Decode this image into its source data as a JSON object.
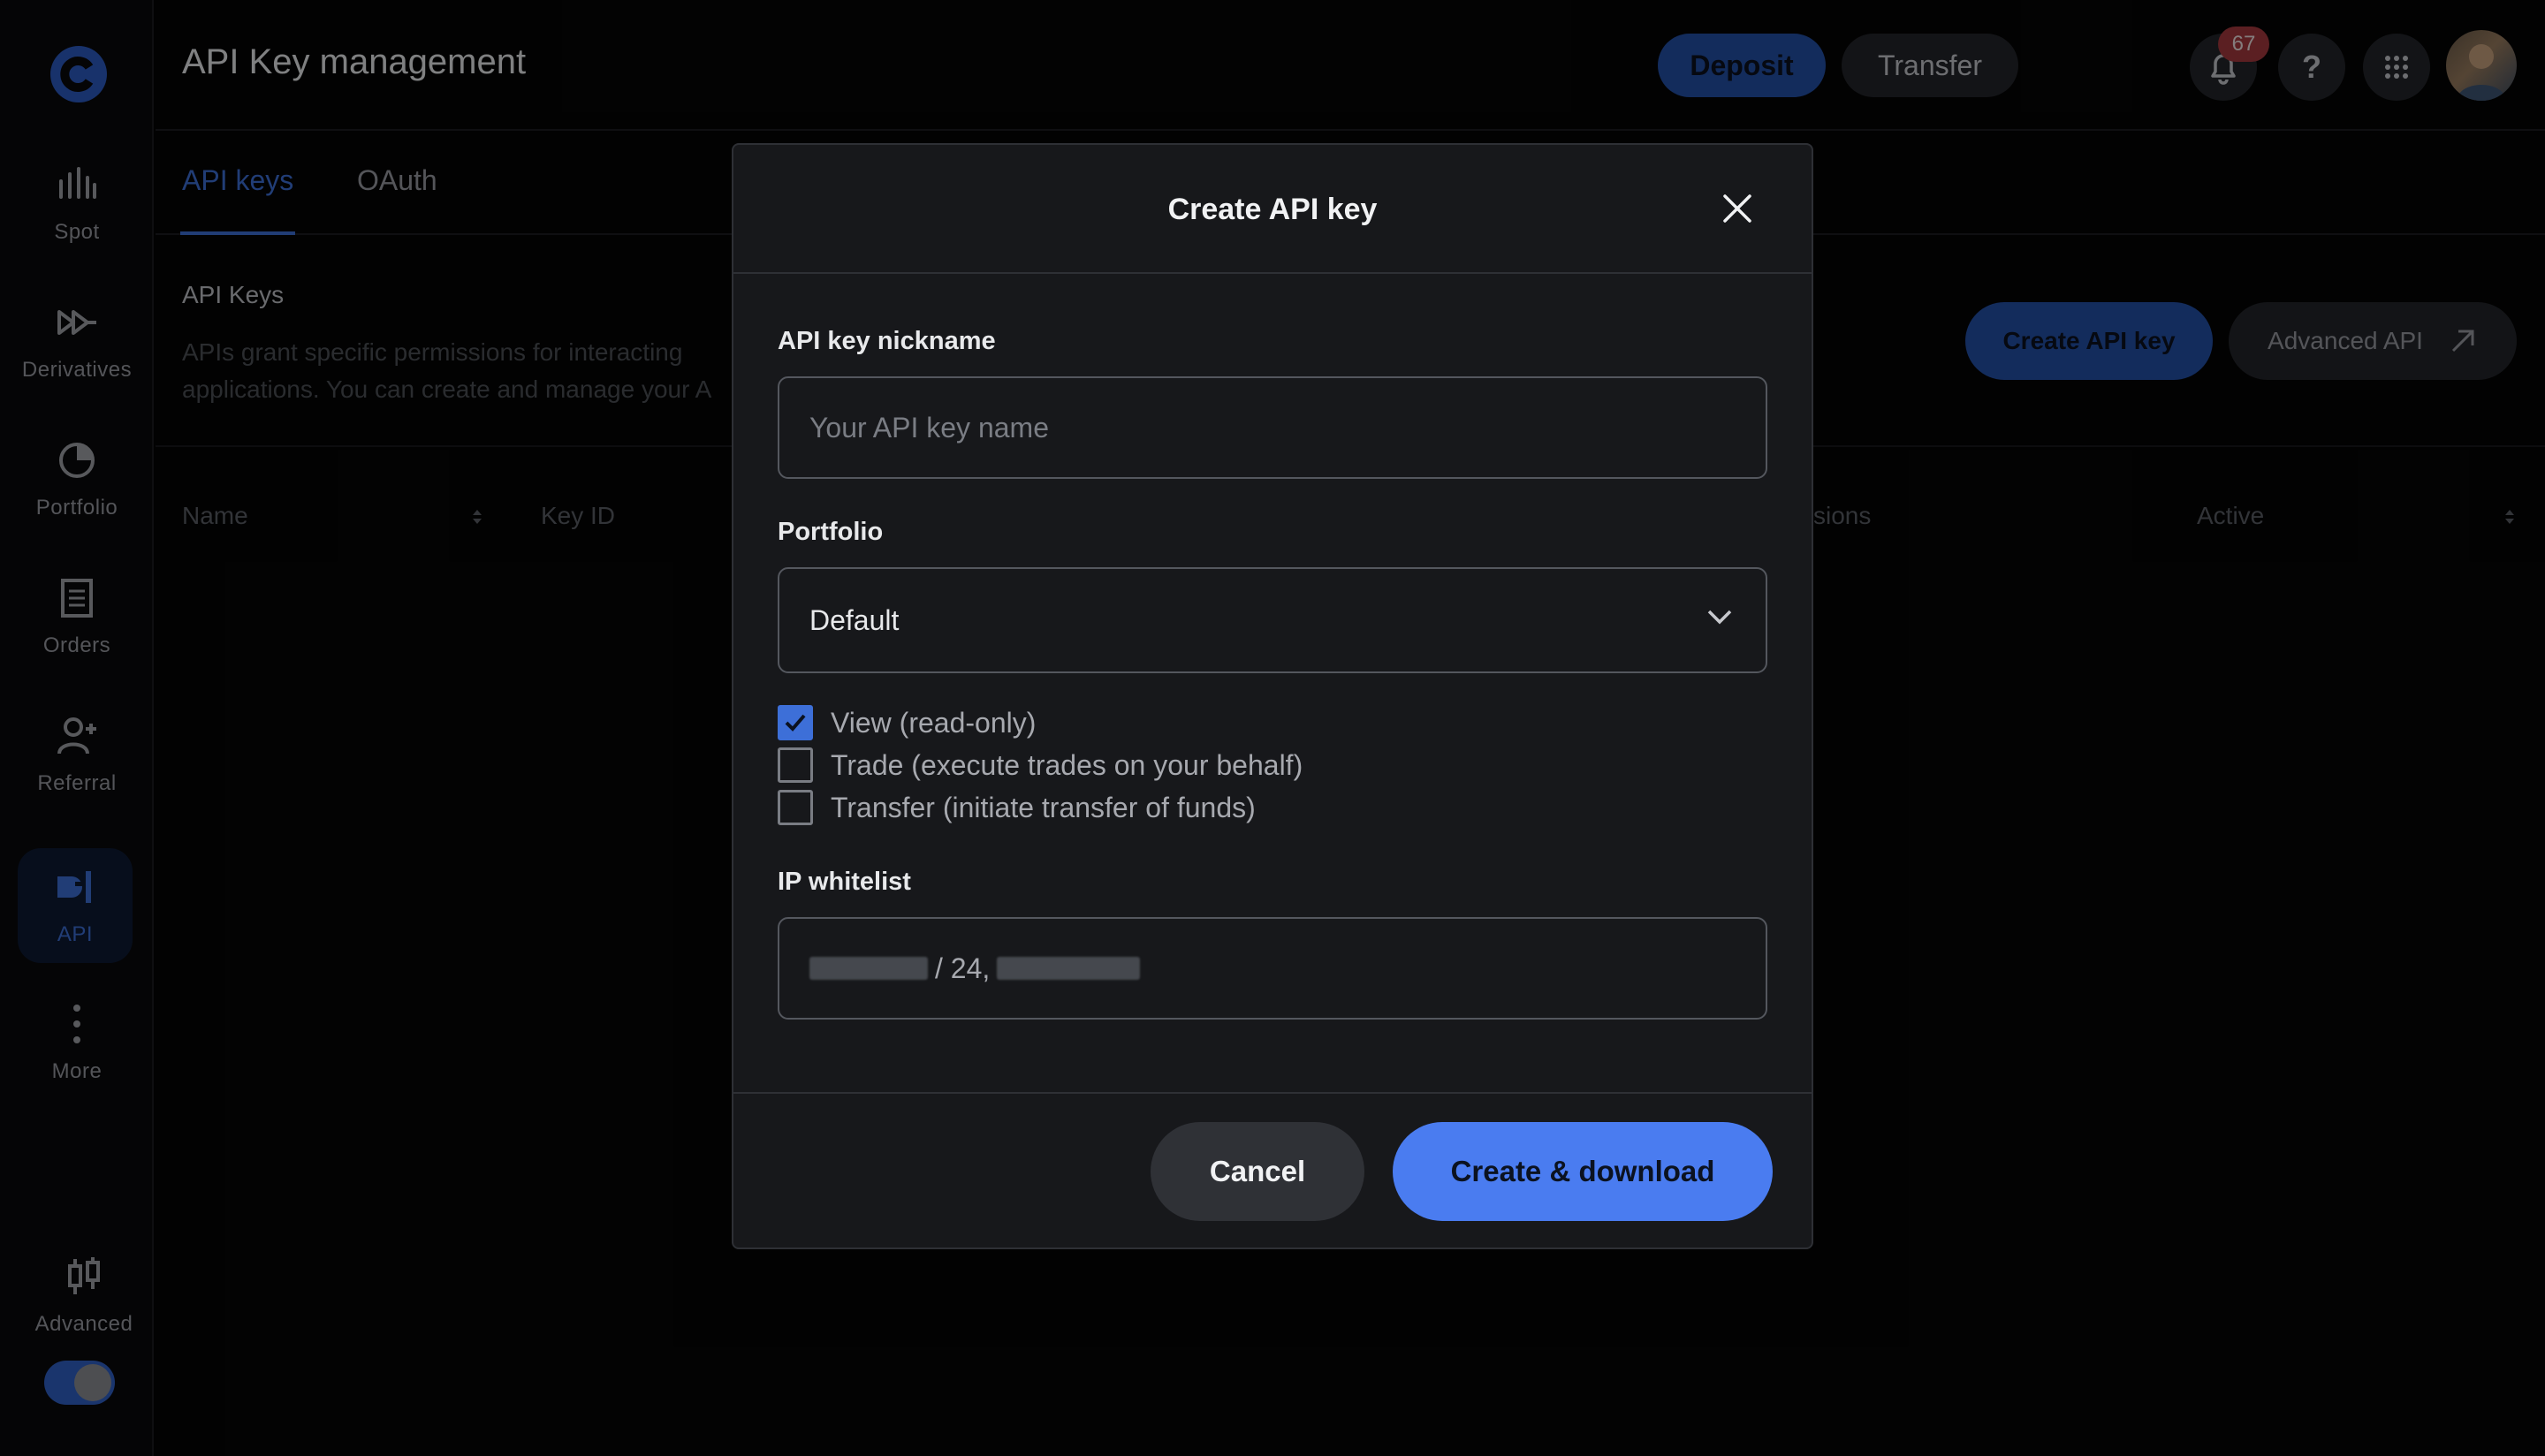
{
  "header": {
    "title": "API Key management",
    "deposit_label": "Deposit",
    "transfer_label": "Transfer",
    "notification_count": "67",
    "help_label": "?"
  },
  "sidebar": {
    "items": [
      {
        "label": "Spot",
        "icon": "spot-chart-icon"
      },
      {
        "label": "Derivatives",
        "icon": "derivatives-icon"
      },
      {
        "label": "Portfolio",
        "icon": "pie-chart-icon"
      },
      {
        "label": "Orders",
        "icon": "orders-list-icon"
      },
      {
        "label": "Referral",
        "icon": "user-plus-icon"
      },
      {
        "label": "API",
        "icon": "api-plug-icon",
        "active": true
      },
      {
        "label": "More",
        "icon": "more-vertical-icon"
      },
      {
        "label": "Advanced",
        "icon": "candlestick-icon"
      }
    ],
    "advanced_toggle_on": true
  },
  "tabs": [
    {
      "label": "API keys",
      "active": true
    },
    {
      "label": "OAuth",
      "active": false
    }
  ],
  "section": {
    "title": "API Keys",
    "description_line1": "APIs grant specific permissions for interacting",
    "description_line2": "applications. You can create and manage your A",
    "create_button": "Create API key",
    "advanced_button": "Advanced API"
  },
  "table": {
    "columns": [
      "Name",
      "Key ID",
      "sions",
      "Active"
    ]
  },
  "modal": {
    "title": "Create API key",
    "nickname_label": "API key nickname",
    "nickname_placeholder": "Your API key name",
    "portfolio_label": "Portfolio",
    "portfolio_value": "Default",
    "permissions": [
      {
        "label": "View (read-only)",
        "checked": true
      },
      {
        "label": "Trade (execute trades on your behalf)",
        "checked": false
      },
      {
        "label": "Transfer (initiate transfer of funds)",
        "checked": false
      }
    ],
    "ip_label": "IP whitelist",
    "ip_visible_text": "/ 24,",
    "cancel_label": "Cancel",
    "create_label": "Create & download"
  },
  "colors": {
    "accent": "#3d6fd8",
    "primary_button": "#4a7cf0",
    "background": "#050505",
    "modal_bg": "#17181b",
    "badge": "#a63a3e"
  }
}
